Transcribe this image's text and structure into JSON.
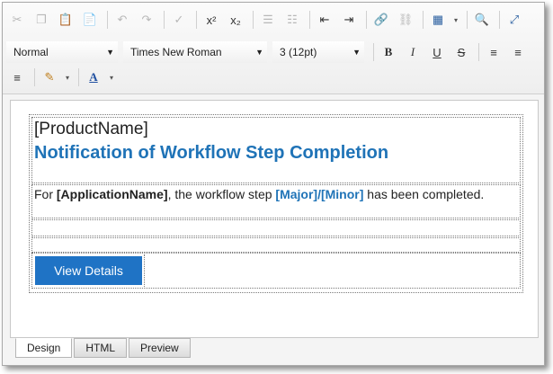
{
  "toolbar": {
    "row1": [
      {
        "name": "cut-icon",
        "glyph": "✂",
        "state": "disabled"
      },
      {
        "name": "copy-icon",
        "glyph": "❐",
        "state": "disabled"
      },
      {
        "name": "paste-icon",
        "glyph": "📋",
        "state": "disabled"
      },
      {
        "name": "paste-special-icon",
        "glyph": "📄",
        "state": "enabled"
      },
      {
        "name": "undo-icon",
        "glyph": "↶",
        "state": "disabled"
      },
      {
        "name": "redo-icon",
        "glyph": "↷",
        "state": "disabled"
      },
      {
        "name": "spellcheck-icon",
        "glyph": "✓",
        "state": "disabled"
      },
      {
        "name": "superscript-icon",
        "glyph": "x²",
        "state": "enabled"
      },
      {
        "name": "subscript-icon",
        "glyph": "x₂",
        "state": "enabled"
      },
      {
        "name": "numbered-list-icon",
        "glyph": "☰",
        "state": "disabled"
      },
      {
        "name": "bullet-list-icon",
        "glyph": "☷",
        "state": "disabled"
      },
      {
        "name": "outdent-icon",
        "glyph": "⇤",
        "state": "enabled"
      },
      {
        "name": "indent-icon",
        "glyph": "⇥",
        "state": "enabled"
      },
      {
        "name": "insert-link-icon",
        "glyph": "🔗",
        "state": "enabled"
      },
      {
        "name": "remove-link-icon",
        "glyph": "⛓",
        "state": "disabled"
      },
      {
        "name": "insert-table-icon",
        "glyph": "▦",
        "state": "enabled"
      },
      {
        "name": "find-replace-icon",
        "glyph": "🔍",
        "state": "enabled"
      },
      {
        "name": "fullscreen-icon",
        "glyph": "⤢",
        "state": "enabled"
      }
    ],
    "format_select": "Normal",
    "font_select": "Times New Roman",
    "size_select": "3 (12pt)",
    "bold_label": "B",
    "italic_label": "I",
    "underline_label": "U",
    "strike_label": "S",
    "align_left_glyph": "≡",
    "align_center_glyph": "≡",
    "align_justify_glyph": "≡",
    "highlight_glyph": "✎",
    "font_color_label": "A"
  },
  "content": {
    "product_name": "[ProductName]",
    "heading": "Notification of Workflow Step Completion",
    "body_prefix": "For ",
    "application_name": "[ApplicationName]",
    "body_mid": ", the workflow step ",
    "major": "[Major]",
    "slash": "/",
    "minor": "[Minor]",
    "body_suffix": " has been completed.",
    "button_label": "View Details"
  },
  "tabs": [
    {
      "label": "Design",
      "active": true
    },
    {
      "label": "HTML",
      "active": false
    },
    {
      "label": "Preview",
      "active": false
    }
  ],
  "colors": {
    "accent": "#1f73b7",
    "button": "#1f73c5"
  }
}
